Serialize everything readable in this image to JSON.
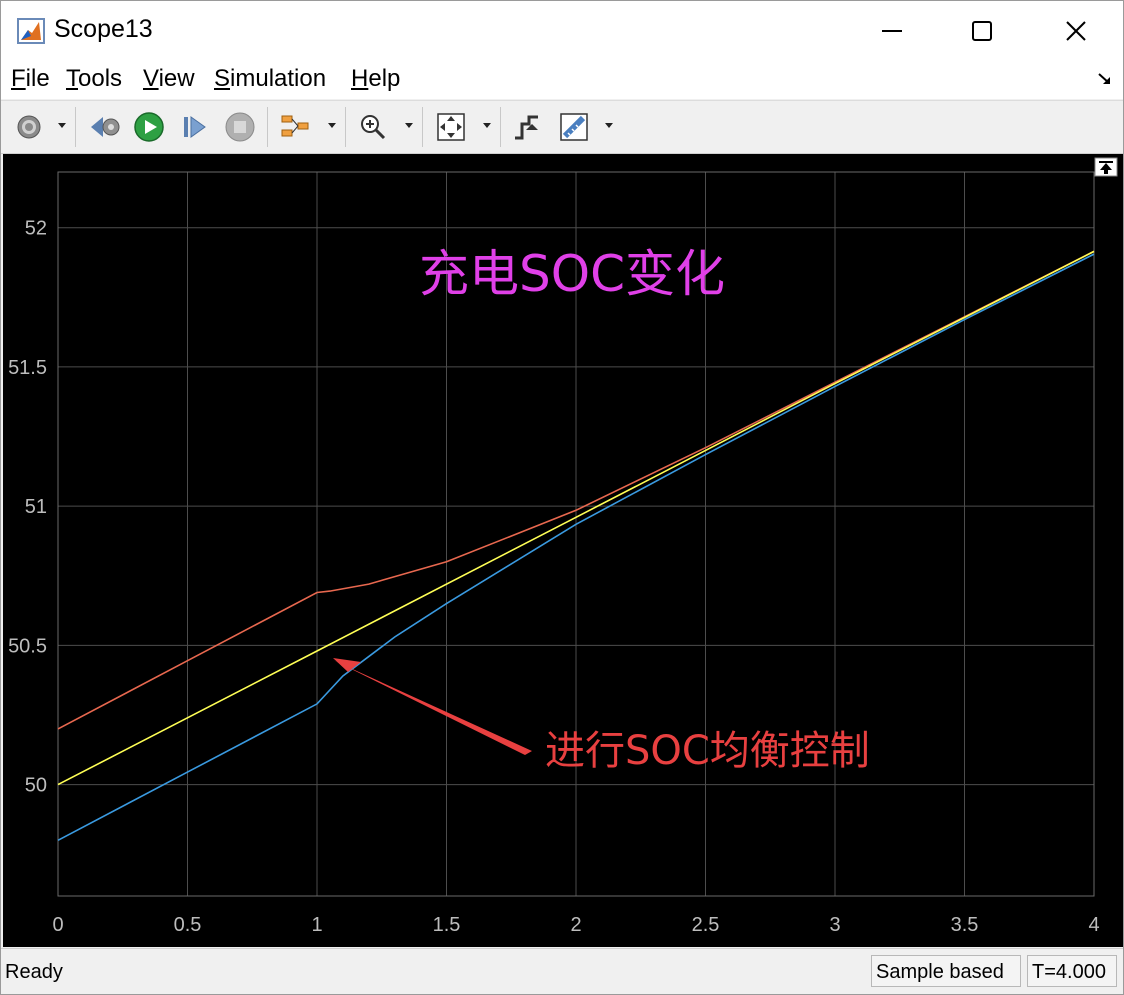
{
  "window": {
    "title": "Scope13"
  },
  "menu": [
    {
      "label": "File",
      "key": "F",
      "rest": "ile"
    },
    {
      "label": "Tools",
      "key": "T",
      "rest": "ools"
    },
    {
      "label": "View",
      "key": "V",
      "rest": "iew"
    },
    {
      "label": "Simulation",
      "key": "S",
      "rest": "imulation"
    },
    {
      "label": "Help",
      "key": "H",
      "rest": "elp"
    }
  ],
  "toolbar": {
    "icons": [
      "gear-icon",
      "step-back-icon",
      "run-icon",
      "step-forward-icon",
      "stop-icon",
      "signal-selector-icon",
      "zoom-icon",
      "fit-axes-icon",
      "triggers-icon",
      "measurements-icon"
    ]
  },
  "status": {
    "ready": "Ready",
    "mode": "Sample based",
    "time": "T=4.000"
  },
  "chart_data": {
    "type": "line",
    "background": "#000000",
    "grid": true,
    "xlim": [
      0,
      4
    ],
    "ylim": [
      49.6,
      52.2
    ],
    "xticks": [
      "0",
      "0.5",
      "1",
      "1.5",
      "2",
      "2.5",
      "3",
      "3.5",
      "4"
    ],
    "yticks": [
      "50",
      "50.5",
      "51",
      "51.5",
      "52"
    ],
    "series": [
      {
        "color": "#e8684f",
        "x": [
          0,
          0.5,
          1,
          1.05,
          1.2,
          1.5,
          2,
          2.5,
          3,
          3.5,
          4
        ],
        "y": [
          50.2,
          50.445,
          50.69,
          50.695,
          50.72,
          50.8,
          50.985,
          51.21,
          51.445,
          51.68,
          51.915
        ]
      },
      {
        "color": "#ffff55",
        "x": [
          0,
          1,
          2,
          3,
          4
        ],
        "y": [
          50.0,
          50.48,
          50.96,
          51.44,
          51.915
        ]
      },
      {
        "color": "#3a9ae0",
        "x": [
          0,
          0.5,
          1,
          1.1,
          1.3,
          1.5,
          2,
          2.5,
          3,
          3.5,
          4
        ],
        "y": [
          49.8,
          50.045,
          50.29,
          50.39,
          50.53,
          50.65,
          50.935,
          51.185,
          51.43,
          51.67,
          51.905
        ]
      }
    ],
    "annotations": [
      {
        "text": "充电SOC变化",
        "color": "#e040e8"
      },
      {
        "text": "进行SOC均衡控制",
        "color": "#e84040"
      }
    ]
  }
}
